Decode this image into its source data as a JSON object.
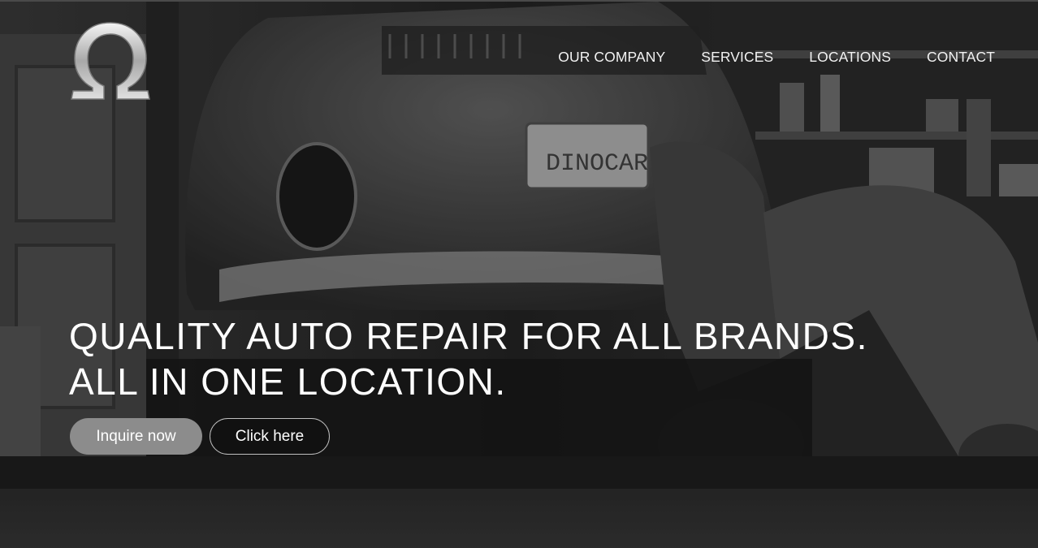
{
  "logo": {
    "icon": "omega-icon",
    "glyph": "Ω"
  },
  "nav": {
    "items": [
      {
        "label": "OUR COMPANY"
      },
      {
        "label": "SERVICES"
      },
      {
        "label": "LOCATIONS"
      },
      {
        "label": "CONTACT"
      }
    ]
  },
  "hero": {
    "headline_line1": "QUALITY AUTO REPAIR FOR ALL BRANDS.",
    "headline_line2": "ALL IN ONE LOCATION.",
    "plate_text": "DINOCAR"
  },
  "buttons": {
    "primary_label": "Inquire now",
    "secondary_label": "Click here"
  },
  "colors": {
    "primary_button": "#8c8c8c",
    "text": "#ffffff",
    "background": "#1a1a1a"
  }
}
